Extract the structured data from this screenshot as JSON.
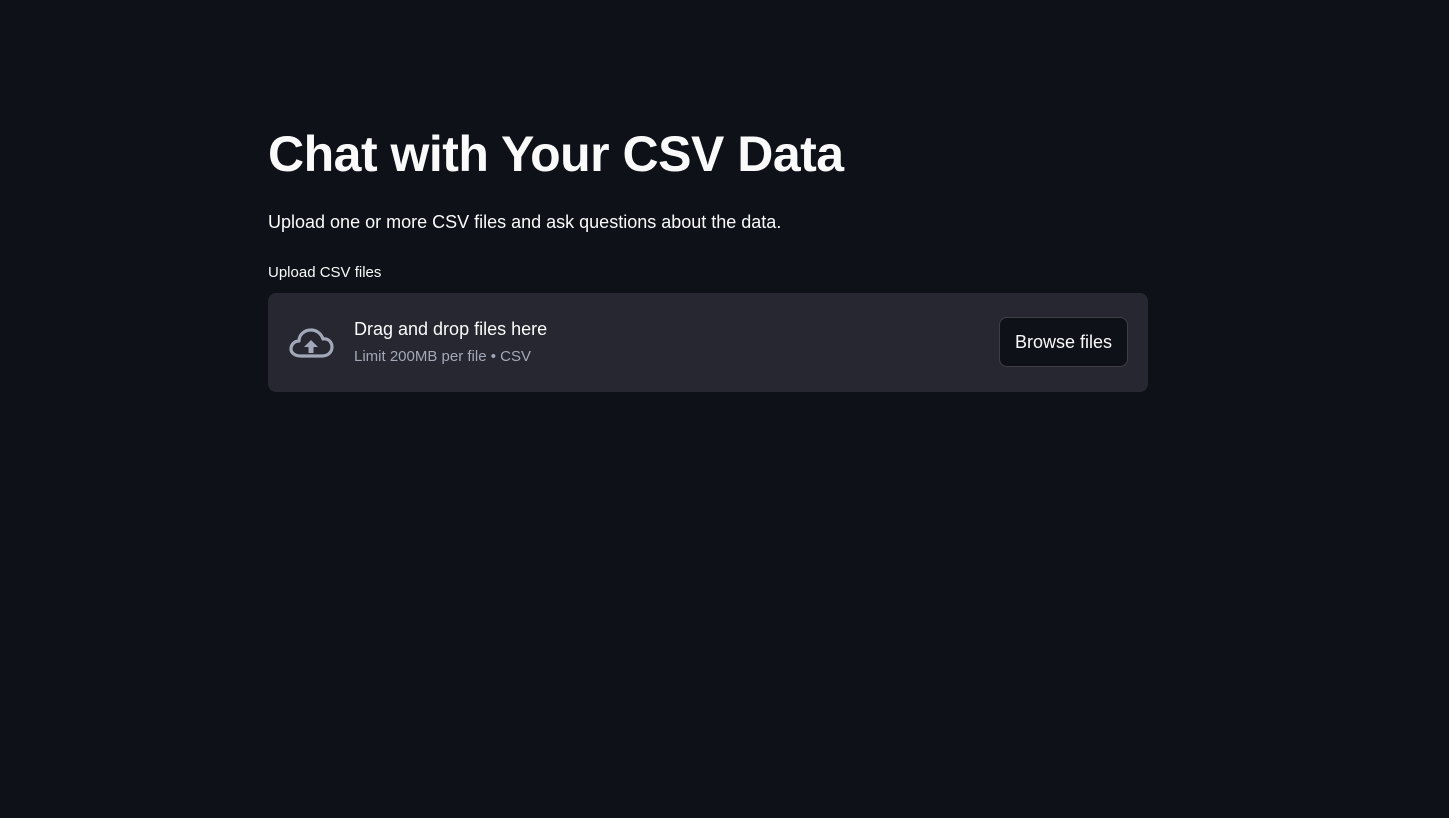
{
  "page": {
    "title": "Chat with Your CSV Data",
    "description": "Upload one or more CSV files and ask questions about the data."
  },
  "uploader": {
    "label": "Upload CSV files",
    "dropzone_title": "Drag and drop files here",
    "dropzone_hint": "Limit 200MB per file • CSV",
    "browse_label": "Browse files",
    "icon": "cloud-upload-icon"
  },
  "colors": {
    "background": "#0e1117",
    "dropzone_background": "#262730",
    "text": "#fafafa",
    "muted_text": "#a3a8b8",
    "icon": "#a3a8b8"
  }
}
